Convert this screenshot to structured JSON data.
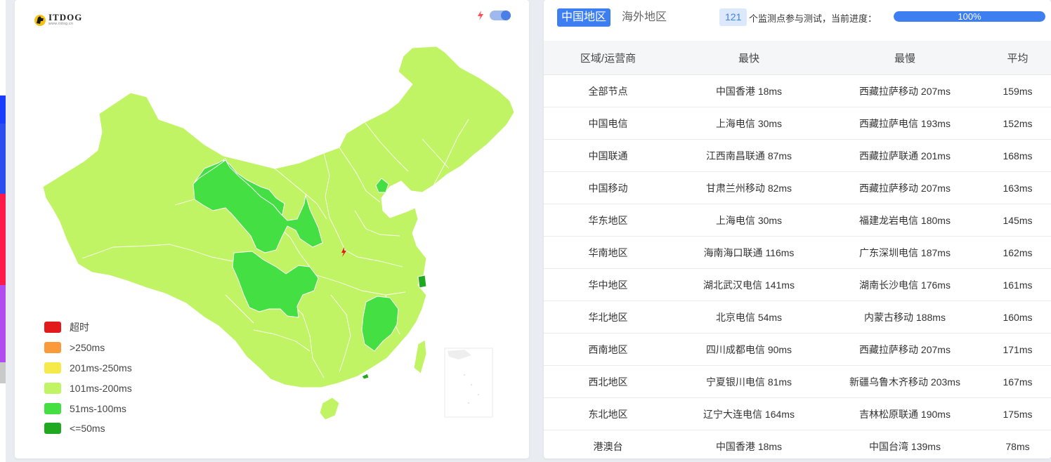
{
  "logo": {
    "text": "ITDOG",
    "sub": "www.itdog.cn"
  },
  "colors": {
    "accent": "#3d7ff0",
    "timeout": "#e31a1c",
    "over250": "#fa9a3a",
    "ms201_250": "#f6e94a",
    "ms101_200": "#c1f464",
    "ms51_100": "#43df43",
    "le50": "#21a821"
  },
  "legend": [
    {
      "label": "超时",
      "color": "#e31a1c"
    },
    {
      "label": ">250ms",
      "color": "#fa9a3a"
    },
    {
      "label": "201ms-250ms",
      "color": "#f6e94a"
    },
    {
      "label": "101ms-200ms",
      "color": "#c1f464"
    },
    {
      "label": "51ms-100ms",
      "color": "#43df43"
    },
    {
      "label": "<=50ms",
      "color": "#21a821"
    }
  ],
  "tabs": {
    "active": "中国地区",
    "other": "海外地区"
  },
  "progress": {
    "count": "121",
    "text": "个监测点参与测试，当前进度：",
    "label": "100%",
    "value": 100
  },
  "table": {
    "headers": [
      "区域/运营商",
      "最快",
      "最慢",
      "平均"
    ],
    "rows": [
      {
        "region": "全部节点",
        "fastest": "中国香港 18ms",
        "slowest": "西藏拉萨移动 207ms",
        "avg": "159ms"
      },
      {
        "region": "中国电信",
        "fastest": "上海电信 30ms",
        "slowest": "西藏拉萨电信 193ms",
        "avg": "152ms"
      },
      {
        "region": "中国联通",
        "fastest": "江西南昌联通 87ms",
        "slowest": "西藏拉萨联通 201ms",
        "avg": "168ms"
      },
      {
        "region": "中国移动",
        "fastest": "甘肃兰州移动 82ms",
        "slowest": "西藏拉萨移动 207ms",
        "avg": "163ms"
      },
      {
        "region": "华东地区",
        "fastest": "上海电信 30ms",
        "slowest": "福建龙岩电信 180ms",
        "avg": "145ms"
      },
      {
        "region": "华南地区",
        "fastest": "海南海口联通 116ms",
        "slowest": "广东深圳电信 187ms",
        "avg": "162ms"
      },
      {
        "region": "华中地区",
        "fastest": "湖北武汉电信 141ms",
        "slowest": "湖南长沙电信 176ms",
        "avg": "161ms"
      },
      {
        "region": "华北地区",
        "fastest": "北京电信 54ms",
        "slowest": "内蒙古移动 188ms",
        "avg": "160ms"
      },
      {
        "region": "西南地区",
        "fastest": "四川成都电信 90ms",
        "slowest": "西藏拉萨移动 207ms",
        "avg": "171ms"
      },
      {
        "region": "西北地区",
        "fastest": "宁夏银川电信 81ms",
        "slowest": "新疆乌鲁木齐移动 203ms",
        "avg": "167ms"
      },
      {
        "region": "东北地区",
        "fastest": "辽宁大连电信 164ms",
        "slowest": "吉林松原联通 190ms",
        "avg": "175ms"
      },
      {
        "region": "港澳台",
        "fastest": "中国香港 18ms",
        "slowest": "中国台湾 139ms",
        "avg": "78ms"
      }
    ]
  }
}
